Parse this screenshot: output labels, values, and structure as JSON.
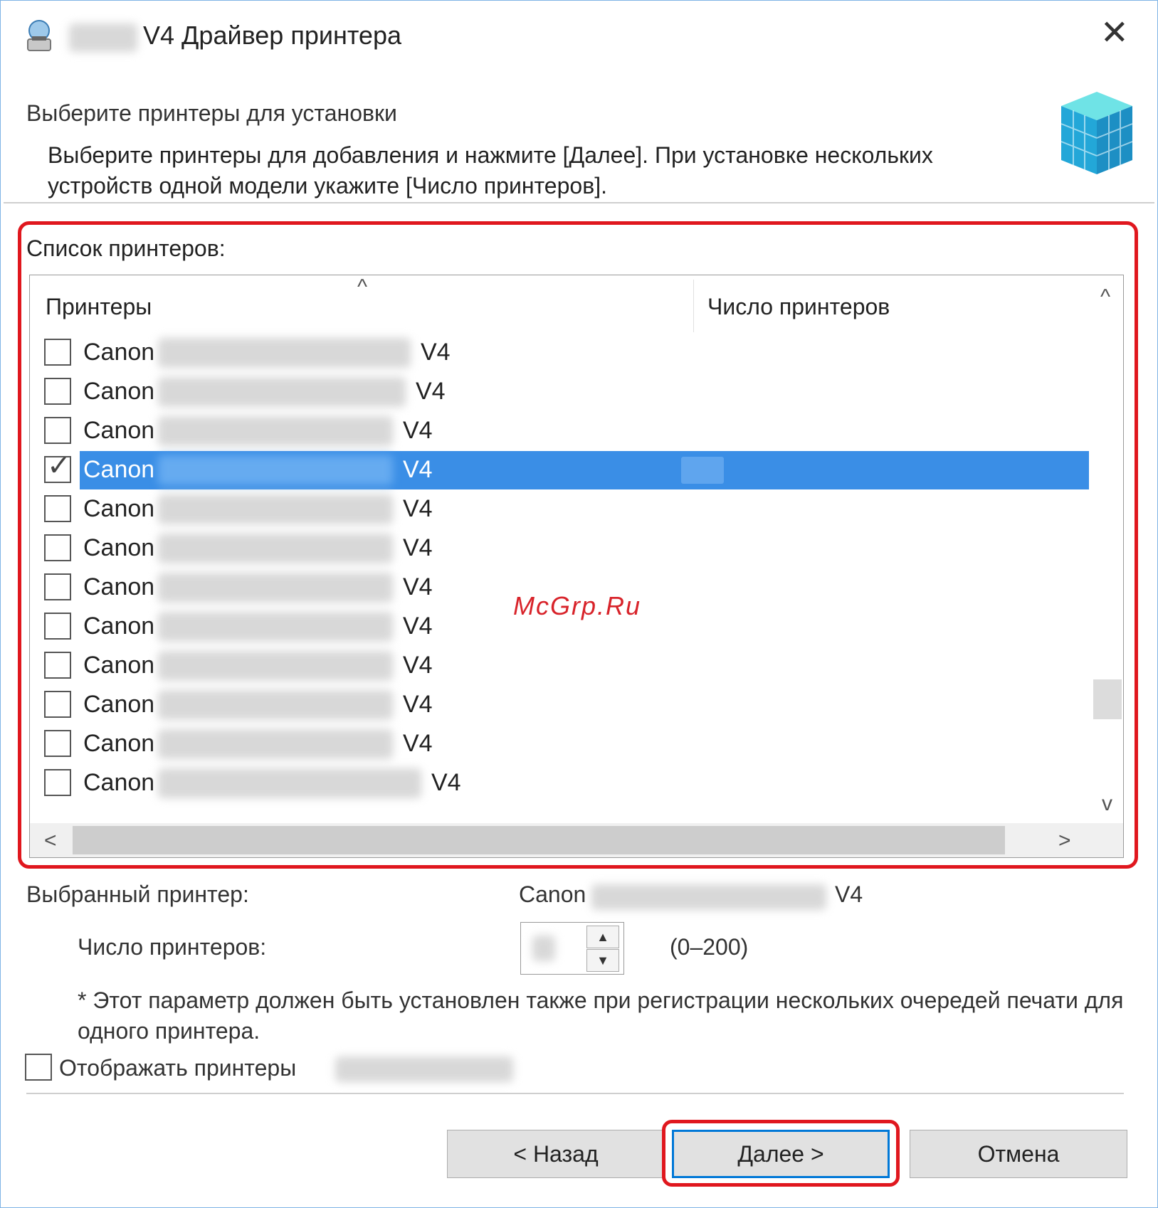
{
  "window": {
    "title": "V4 Драйвер принтера",
    "close_glyph": "✕"
  },
  "header": {
    "title": "Выберите принтеры для установки",
    "description": "Выберите принтеры для добавления и нажмите [Далее]. При установке нескольких устройств одной модели укажите [Число принтеров]."
  },
  "printer_list": {
    "label": "Список принтеров:",
    "sort_glyph": "^",
    "columns": [
      "Принтеры",
      "Число принтеров"
    ],
    "rows": [
      {
        "name": "Canon",
        "suffix": "V4",
        "checked": false,
        "selected": false
      },
      {
        "name": "Canon",
        "suffix": "V4",
        "checked": false,
        "selected": false
      },
      {
        "name": "Canon",
        "suffix": "V4",
        "checked": false,
        "selected": false
      },
      {
        "name": "Canon",
        "suffix": "V4",
        "checked": true,
        "selected": true
      },
      {
        "name": "Canon",
        "suffix": "V4",
        "checked": false,
        "selected": false
      },
      {
        "name": "Canon",
        "suffix": "V4",
        "checked": false,
        "selected": false
      },
      {
        "name": "Canon",
        "suffix": "V4",
        "checked": false,
        "selected": false
      },
      {
        "name": "Canon",
        "suffix": "V4",
        "checked": false,
        "selected": false
      },
      {
        "name": "Canon",
        "suffix": "V4",
        "checked": false,
        "selected": false
      },
      {
        "name": "Canon",
        "suffix": "V4",
        "checked": false,
        "selected": false
      },
      {
        "name": "Canon",
        "suffix": "V4",
        "checked": false,
        "selected": false
      },
      {
        "name": "Canon",
        "suffix": "V4",
        "checked": false,
        "selected": false
      }
    ],
    "check_glyph": "✓",
    "scroll_up_glyph": "^",
    "scroll_down_glyph": "v",
    "scroll_left_glyph": "<",
    "scroll_right_glyph": ">"
  },
  "selected_printer": {
    "label": "Выбранный принтер:",
    "name": "Canon",
    "suffix": "V4"
  },
  "printer_count": {
    "label": "Число принтеров:",
    "range": "(0–200)",
    "up_glyph": "▲",
    "down_glyph": "▼"
  },
  "note": "* Этот параметр должен быть установлен также при регистрации нескольких очередей печати для одного принтера.",
  "show_printers": {
    "label": "Отображать принтеры"
  },
  "buttons": {
    "back": "< Назад",
    "next": "Далее >",
    "cancel": "Отмена"
  },
  "watermark": "McGrp.Ru",
  "colors": {
    "selection": "#3a8ee6",
    "highlight_frame": "#e0171e",
    "primary_border": "#0078d7",
    "window_border": "#7fb4e6"
  },
  "icons": [
    "installer-icon",
    "printer-cubes-icon",
    "close-icon",
    "checkmark-icon",
    "chevron-up-icon",
    "chevron-down-icon",
    "chevron-left-icon",
    "chevron-right-icon"
  ]
}
